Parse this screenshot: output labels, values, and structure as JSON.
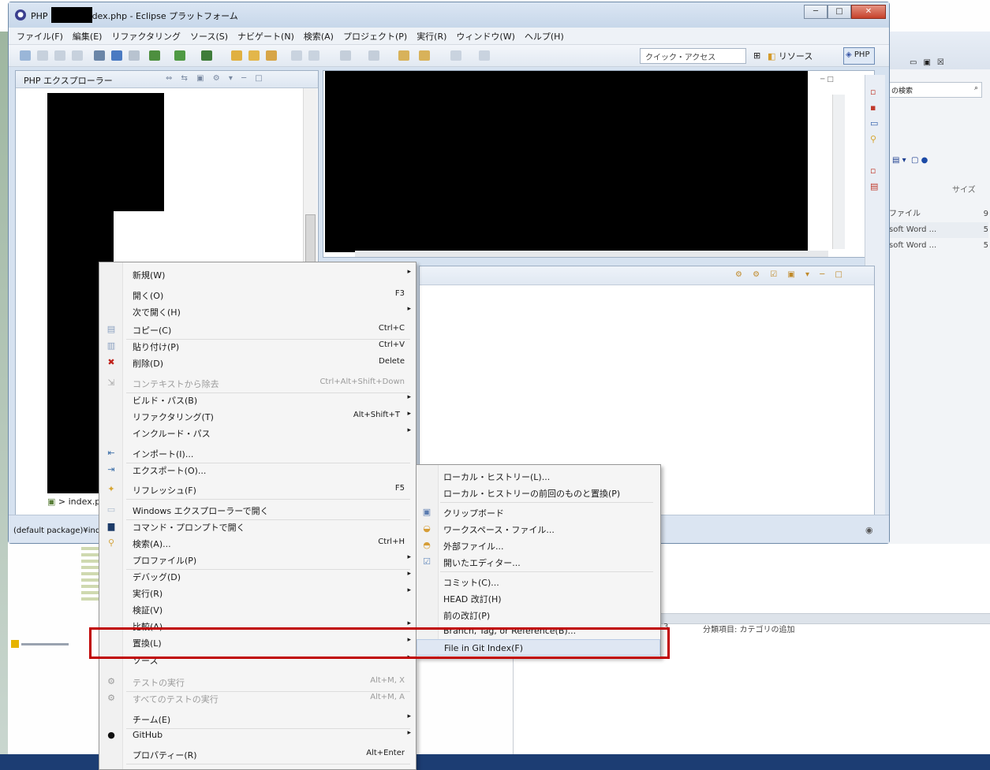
{
  "window": {
    "app_name": "PHP",
    "title_suffix": "index.php - Eclipse プラットフォーム",
    "minimize": "─",
    "maximize": "□",
    "close": "✕"
  },
  "menubar": [
    "ファイル(F)",
    "編集(E)",
    "リファクタリング",
    "ソース(S)",
    "ナビゲート(N)",
    "検索(A)",
    "プロジェクト(P)",
    "実行(R)",
    "ウィンドウ(W)",
    "ヘルプ(H)"
  ],
  "toolbar": {
    "quick_access": "クイック・アクセス",
    "resource_perspective": "リソース",
    "php_perspective": "PHP"
  },
  "explorer": {
    "title": "PHP エクスプローラー",
    "tree_item": "> index.p"
  },
  "status_bar": {
    "text": "(default package)¥ind"
  },
  "background_window": {
    "search_placeholder": "の検索",
    "column_size": "サイズ",
    "rows": [
      "ファイル",
      "soft Word ...",
      "soft Word ..."
    ],
    "row_values": [
      "9",
      "5",
      "5"
    ]
  },
  "lower_background": {
    "category_label": "分類項目: カテゴリの追加",
    "prefix": "3"
  },
  "context_menu": {
    "items": [
      {
        "label": "新規(W)",
        "shortcut": "",
        "arrow": true,
        "icon": ""
      },
      {
        "label": "開く(O)",
        "shortcut": "F3",
        "arrow": false,
        "icon": ""
      },
      {
        "label": "次で開く(H)",
        "shortcut": "",
        "arrow": true,
        "icon": ""
      },
      {
        "label": "コピー(C)",
        "shortcut": "Ctrl+C",
        "arrow": false,
        "icon": "copy"
      },
      {
        "label": "貼り付け(P)",
        "shortcut": "Ctrl+V",
        "arrow": false,
        "icon": "paste"
      },
      {
        "label": "削除(D)",
        "shortcut": "Delete",
        "arrow": false,
        "icon": "delete"
      },
      {
        "label": "コンテキストから除去",
        "shortcut": "Ctrl+Alt+Shift+Down",
        "arrow": false,
        "icon": "remove",
        "disabled": true
      },
      {
        "label": "ビルド・パス(B)",
        "shortcut": "",
        "arrow": true,
        "icon": ""
      },
      {
        "label": "リファクタリング(T)",
        "shortcut": "Alt+Shift+T",
        "arrow": true,
        "icon": ""
      },
      {
        "label": "インクルード・パス",
        "shortcut": "",
        "arrow": true,
        "icon": ""
      },
      {
        "label": "インポート(I)...",
        "shortcut": "",
        "arrow": false,
        "icon": "import"
      },
      {
        "label": "エクスポート(O)...",
        "shortcut": "",
        "arrow": false,
        "icon": "export"
      },
      {
        "label": "リフレッシュ(F)",
        "shortcut": "F5",
        "arrow": false,
        "icon": "refresh"
      },
      {
        "label": "Windows エクスプローラーで開く",
        "shortcut": "",
        "arrow": false,
        "icon": "folder"
      },
      {
        "label": "コマンド・プロンプトで開く",
        "shortcut": "",
        "arrow": false,
        "icon": "terminal"
      },
      {
        "label": "検索(A)...",
        "shortcut": "Ctrl+H",
        "arrow": false,
        "icon": "search"
      },
      {
        "label": "プロファイル(P)",
        "shortcut": "",
        "arrow": true,
        "icon": ""
      },
      {
        "label": "デバッグ(D)",
        "shortcut": "",
        "arrow": true,
        "icon": ""
      },
      {
        "label": "実行(R)",
        "shortcut": "",
        "arrow": true,
        "icon": ""
      },
      {
        "label": "検証(V)",
        "shortcut": "",
        "arrow": false,
        "icon": ""
      },
      {
        "label": "比較(A)",
        "shortcut": "",
        "arrow": true,
        "icon": ""
      },
      {
        "label": "置換(L)",
        "shortcut": "",
        "arrow": true,
        "icon": "",
        "highlighted": true
      },
      {
        "label": "ソース",
        "shortcut": "",
        "arrow": true,
        "icon": ""
      },
      {
        "label": "テストの実行",
        "shortcut": "Alt+M, X",
        "arrow": false,
        "icon": "test",
        "disabled": true
      },
      {
        "label": "すべてのテストの実行",
        "shortcut": "Alt+M, A",
        "arrow": false,
        "icon": "test",
        "disabled": true
      },
      {
        "label": "チーム(E)",
        "shortcut": "",
        "arrow": true,
        "icon": ""
      },
      {
        "label": "GitHub",
        "shortcut": "",
        "arrow": true,
        "icon": "github"
      },
      {
        "label": "プロパティー(R)",
        "shortcut": "Alt+Enter",
        "arrow": false,
        "icon": ""
      }
    ]
  },
  "submenu": {
    "items": [
      {
        "label": "ローカル・ヒストリー(L)...",
        "icon": ""
      },
      {
        "label": "ローカル・ヒストリーの前回のものと置換(P)",
        "icon": ""
      },
      {
        "label": "クリップボード",
        "icon": "clipboard"
      },
      {
        "label": "ワークスペース・ファイル...",
        "icon": "workspace"
      },
      {
        "label": "外部ファイル...",
        "icon": "external"
      },
      {
        "label": "開いたエディター...",
        "icon": "editor"
      },
      {
        "label": "コミット(C)...",
        "icon": ""
      },
      {
        "label": "HEAD 改訂(H)",
        "icon": ""
      },
      {
        "label": "前の改訂(P)",
        "icon": ""
      },
      {
        "label": "Branch, Tag, or Reference(B)...",
        "icon": ""
      },
      {
        "label": "File in Git Index(F)",
        "icon": "",
        "highlighted": true
      }
    ]
  },
  "colors": {
    "highlight_box": "#c00000",
    "taskbar": "#1c3d73",
    "menu_bg": "#f5f5f5"
  }
}
